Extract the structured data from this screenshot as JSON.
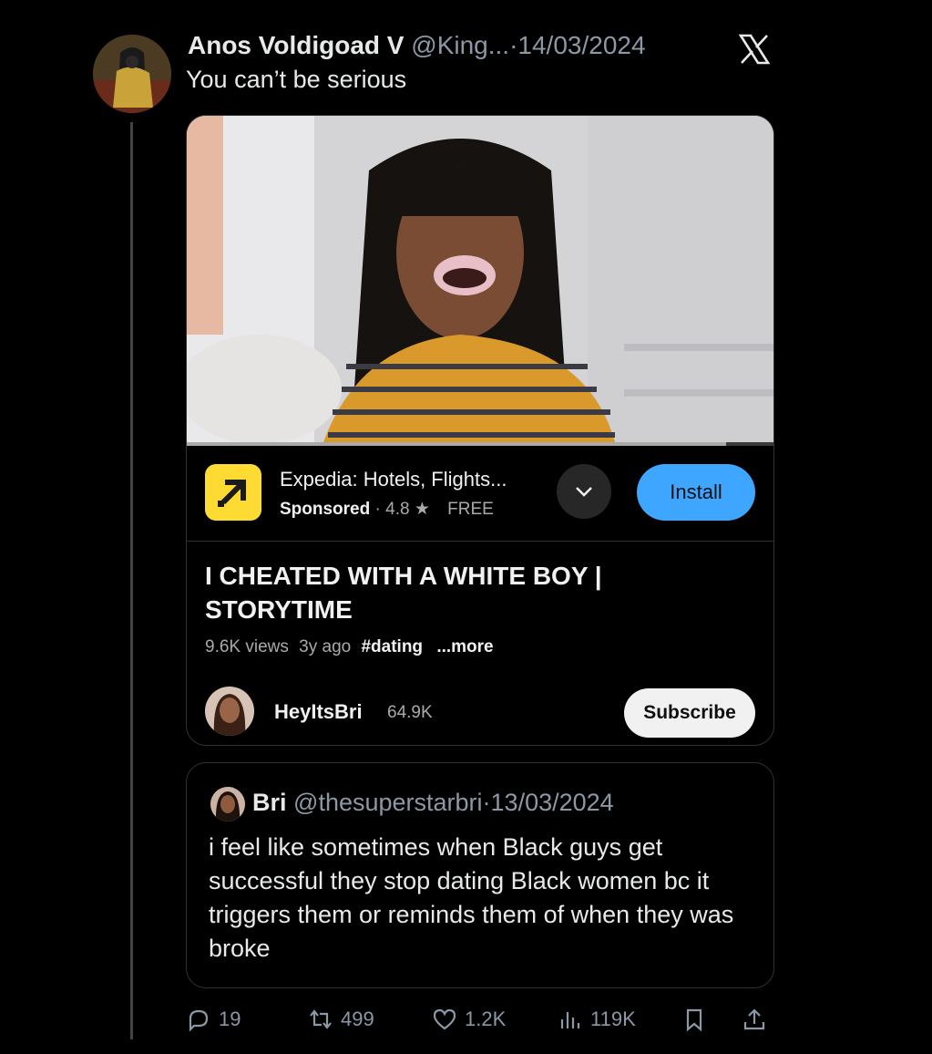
{
  "tweet": {
    "author_name": "Anos Voldigoad V",
    "author_handle": "@King...",
    "separator": "·",
    "date": "14/03/2024",
    "text": "You can’t be serious"
  },
  "youtube_card": {
    "progress_fraction": 0.92,
    "ad": {
      "app_name": "Expedia: Hotels, Flights...",
      "sponsored": "Sponsored",
      "dot": "·",
      "rating": "4.8",
      "price": "FREE",
      "install_label": "Install"
    },
    "video": {
      "title": "I CHEATED WITH A WHITE BOY | STORYTIME",
      "views": "9.6K views",
      "age": "3y ago",
      "hashtag": "#dating",
      "more": "...more"
    },
    "channel": {
      "name": "HeyItsBri",
      "subscribers": "64.9K",
      "subscribe_label": "Subscribe"
    }
  },
  "quoted_tweet": {
    "author_name": "Bri",
    "author_handle": "@thesuperstarbri",
    "separator": "·",
    "date": "13/03/2024",
    "text": "i feel like sometimes when Black guys get successful they stop dating Black women bc it triggers them or reminds them of when they was broke"
  },
  "actions": {
    "replies": "19",
    "retweets": "499",
    "likes": "1.2K",
    "views": "119K"
  },
  "icons": {
    "logo": "x-logo-icon",
    "reply": "reply-icon",
    "retweet": "retweet-icon",
    "like": "heart-icon",
    "views": "views-chart-icon",
    "bookmark": "bookmark-icon",
    "share": "share-icon"
  },
  "colors": {
    "background": "#000000",
    "muted_text": "#8b98a5",
    "install_blue": "#3ea6ff",
    "expedia_yellow": "#fddb32"
  }
}
